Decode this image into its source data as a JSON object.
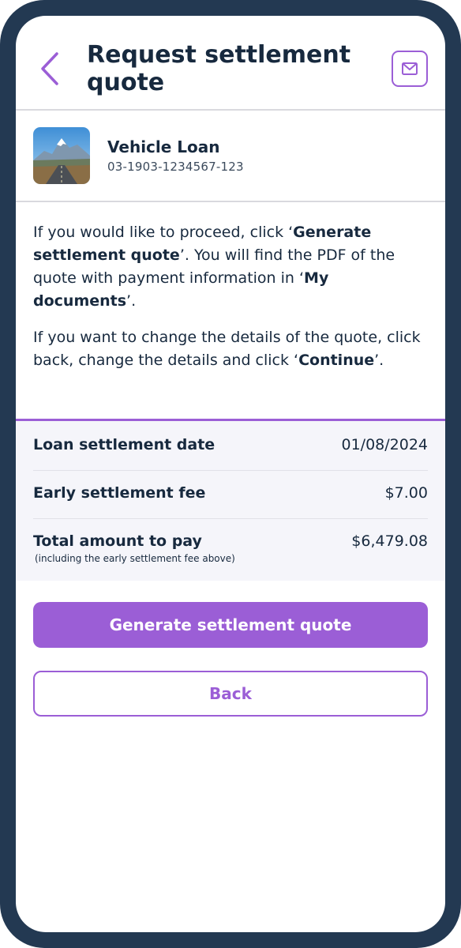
{
  "header": {
    "title": "Request settlement quote",
    "back_icon": "chevron-left-icon",
    "mail_icon": "envelope-icon"
  },
  "account": {
    "name": "Vehicle Loan",
    "number": "03-1903-1234567-123"
  },
  "info": {
    "p1": {
      "a": "If you would like to proceed, click ‘",
      "b": "Generate settlement quote",
      "c": "’. You will find the PDF of the quote with payment information in ‘",
      "d": "My documents",
      "e": "’."
    },
    "p2": {
      "a": "If you want to change the details of the quote, click back, change the details and click ‘",
      "b": "Continue",
      "c": "’."
    }
  },
  "summary": {
    "rows": [
      {
        "label": "Loan settlement date",
        "value": "01/08/2024"
      },
      {
        "label": "Early settlement fee",
        "value": "$7.00"
      },
      {
        "label": "Total amount to pay",
        "value": "$6,479.08",
        "sub": "(including the early settlement fee above)"
      }
    ]
  },
  "actions": {
    "primary_label": "Generate settlement quote",
    "secondary_label": "Back"
  },
  "colors": {
    "accent": "#9b5ed6",
    "text": "#17293e",
    "frame": "#233952",
    "panel": "#f5f5fa"
  }
}
